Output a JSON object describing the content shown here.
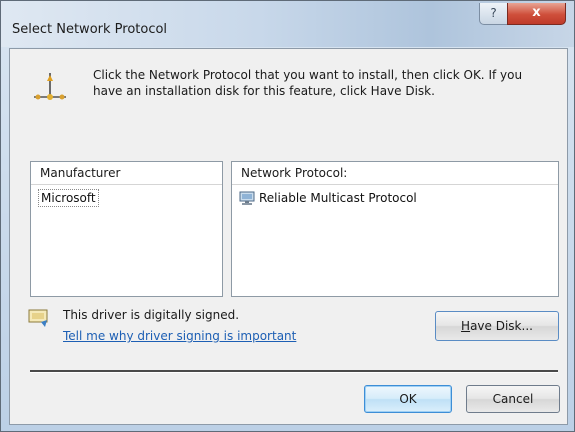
{
  "window": {
    "title": "Select Network Protocol",
    "help_label": "?",
    "close_label": "x"
  },
  "intro": {
    "text": "Click the Network Protocol that you want to install, then click OK. If you have an installation disk for this feature, click Have Disk."
  },
  "manufacturer_list": {
    "header": "Manufacturer",
    "items": [
      "Microsoft"
    ]
  },
  "protocol_list": {
    "header": "Network Protocol:",
    "items": [
      "Reliable Multicast Protocol"
    ]
  },
  "signing": {
    "status": "This driver is digitally signed.",
    "link": "Tell me why driver signing is important"
  },
  "buttons": {
    "have_disk_underline": "H",
    "have_disk_rest": "ave Disk...",
    "ok": "OK",
    "cancel": "Cancel"
  },
  "colors": {
    "link": "#1d5fb4",
    "close_button": "#cf4f3b",
    "client_background": "#f0f0f0"
  },
  "icons": {
    "intro": "network-protocol-icon",
    "protocol_item": "network-adapter-icon",
    "signed": "signed-driver-icon"
  }
}
